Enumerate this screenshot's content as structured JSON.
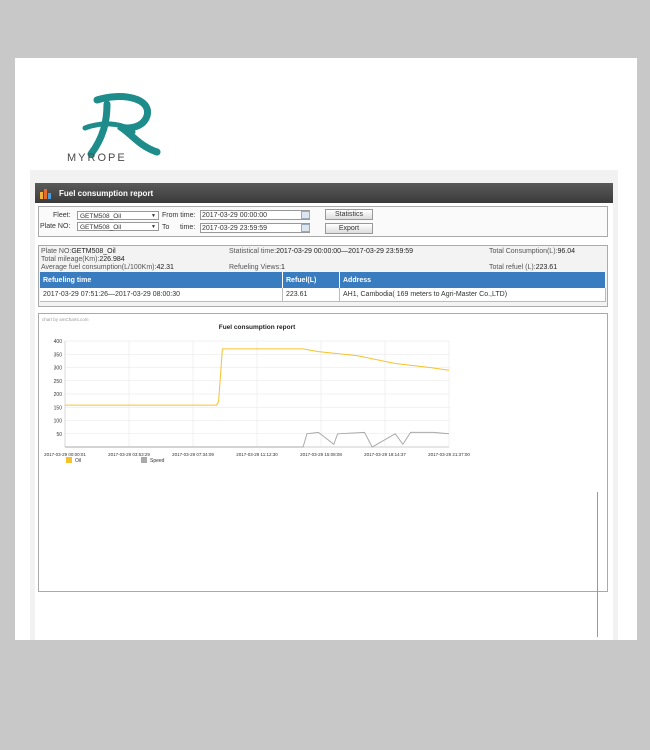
{
  "brand": {
    "name": "MYROPE",
    "color": "#1f8c8c"
  },
  "report": {
    "title": "Fuel consumption report"
  },
  "filters": {
    "fleet_label": "Fleet:",
    "fleet_value": "GETM508_Oil",
    "plate_label": "Plate NO:",
    "plate_value": "GETM508_Oil",
    "from_label": "From time:",
    "from_value": "2017-03-29 00:00:00",
    "to_label": "To",
    "time_label": "time:",
    "to_value": "2017-03-29 23:59:59",
    "statistics_button": "Statistics",
    "export_button": "Export"
  },
  "summary": {
    "plate_label": "Plate NO:",
    "plate_value": "GETM508_Oil",
    "mileage_label": "Total mileage(Km):",
    "mileage_value": "226.984",
    "avg_label": "Average fuel consumption(L/100Km):",
    "avg_value": "42.31",
    "stat_time_label": "Statistical time:",
    "stat_time_value": "2017-03-29 00:00:00—2017-03-29 23:59:59",
    "refuel_views_label": "Refueling Views:",
    "refuel_views_value": "1",
    "total_consumption_label": "Total Consumption(L):",
    "total_consumption_value": "96.04",
    "total_refuel_label": "Total refuel (L):",
    "total_refuel_value": "223.61"
  },
  "refuel_table": {
    "headers": [
      "Refueling time",
      "Refuel(L)",
      "Address"
    ],
    "rows": [
      [
        "2017-03-29 07:51:26—2017-03-29 08:00:30",
        "223.61",
        "AH1, Cambodia( 169 meters to Agri-Master Co.,LTD)"
      ]
    ]
  },
  "chart_data": {
    "type": "line",
    "credit": "chart by amCharts.com",
    "title": "Fuel consumption report",
    "ylim": [
      0,
      400
    ],
    "yticks": [
      "400",
      "350",
      "300",
      "250",
      "200",
      "150",
      "100",
      "50"
    ],
    "xticks": [
      "2017-03-29 00:00:01",
      "2017-03-29 03:53:29",
      "2017-03-29 07:34:09",
      "2017-03-29 11:12:30",
      "2017-03-29 15:08:08",
      "2017-03-29 18:14:37",
      "2017-03-29 21:37:00"
    ],
    "series": [
      {
        "name": "Oil",
        "color": "#f7c12c",
        "points": [
          [
            0,
            158
          ],
          [
            0.395,
            158
          ],
          [
            0.4,
            172
          ],
          [
            0.41,
            370
          ],
          [
            0.62,
            370
          ],
          [
            0.66,
            360
          ],
          [
            0.76,
            345
          ],
          [
            0.86,
            315
          ],
          [
            0.95,
            300
          ],
          [
            1.0,
            290
          ]
        ]
      },
      {
        "name": "Speed",
        "color": "#aaaaaa",
        "points": [
          [
            0,
            0
          ],
          [
            0.62,
            0
          ],
          [
            0.63,
            50
          ],
          [
            0.66,
            55
          ],
          [
            0.7,
            10
          ],
          [
            0.71,
            50
          ],
          [
            0.78,
            55
          ],
          [
            0.8,
            0
          ],
          [
            0.86,
            50
          ],
          [
            0.88,
            10
          ],
          [
            0.9,
            55
          ],
          [
            0.96,
            55
          ],
          [
            1.0,
            50
          ]
        ]
      }
    ]
  }
}
